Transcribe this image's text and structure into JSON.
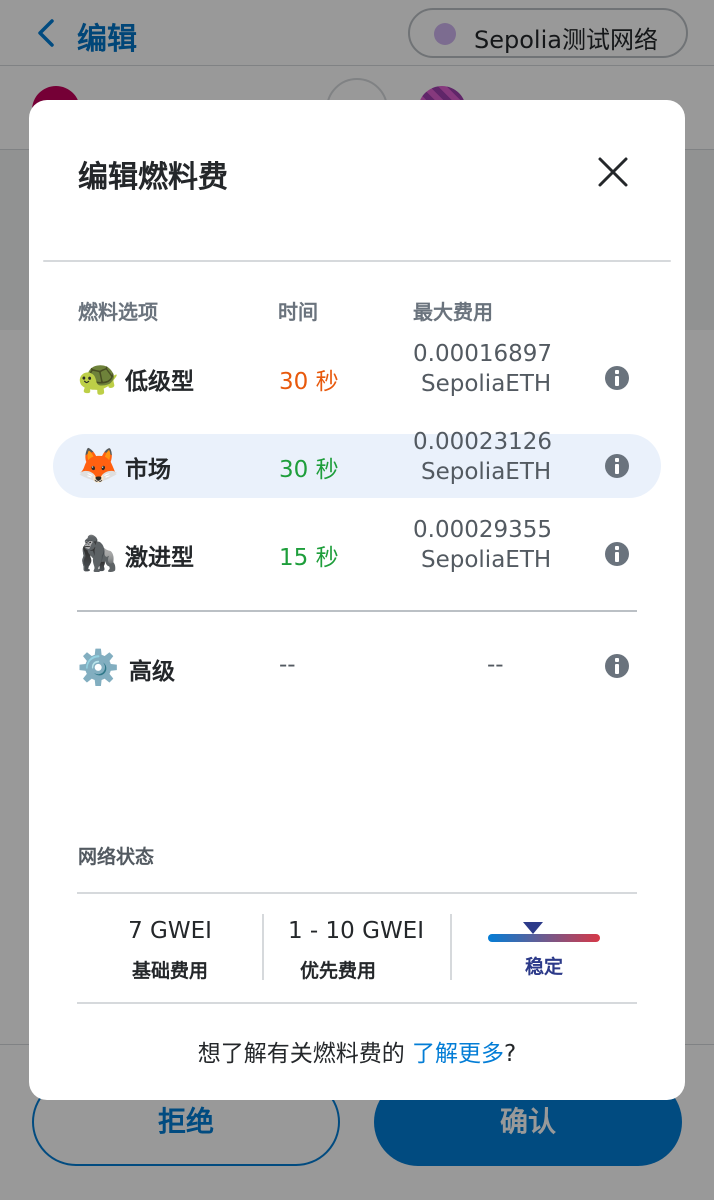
{
  "header": {
    "back_label": "编辑",
    "network": "Sepolia测试网络"
  },
  "footer": {
    "reject_label": "拒绝",
    "confirm_label": "确认"
  },
  "modal": {
    "title": "编辑燃料费",
    "columns": {
      "option": "燃料选项",
      "time": "时间",
      "max_fee": "最大费用"
    },
    "options": [
      {
        "emoji": "🐢",
        "label": "低级型",
        "time": "30 秒",
        "time_color": "#e8590c",
        "fee": "0.00016897",
        "unit": "SepoliaETH",
        "selected": false
      },
      {
        "emoji": "🦊",
        "label": "市场",
        "time": "30 秒",
        "time_color": "#1e9e3b",
        "fee": "0.00023126",
        "unit": "SepoliaETH",
        "selected": true
      },
      {
        "emoji": "🦍",
        "label": "激进型",
        "time": "15 秒",
        "time_color": "#1e9e3b",
        "fee": "0.00029355",
        "unit": "SepoliaETH",
        "selected": false
      }
    ],
    "advanced": {
      "emoji": "⚙️",
      "label": "高级",
      "time": "--",
      "fee": "--"
    },
    "network_status": {
      "label": "网络状态",
      "base_fee_value": "7 GWEI",
      "base_fee_caption": "基础费用",
      "priority_fee_value": "1 - 10 GWEI",
      "priority_fee_caption": "优先费用",
      "stability_label": "稳定"
    },
    "learn_more": {
      "prefix": "想了解有关燃料费的 ",
      "link": "了解更多",
      "suffix": "?"
    }
  },
  "colors": {
    "accent": "#037dd6",
    "selected_row": "#eaf1fb",
    "orange": "#e8590c",
    "green": "#1e9e3b"
  }
}
